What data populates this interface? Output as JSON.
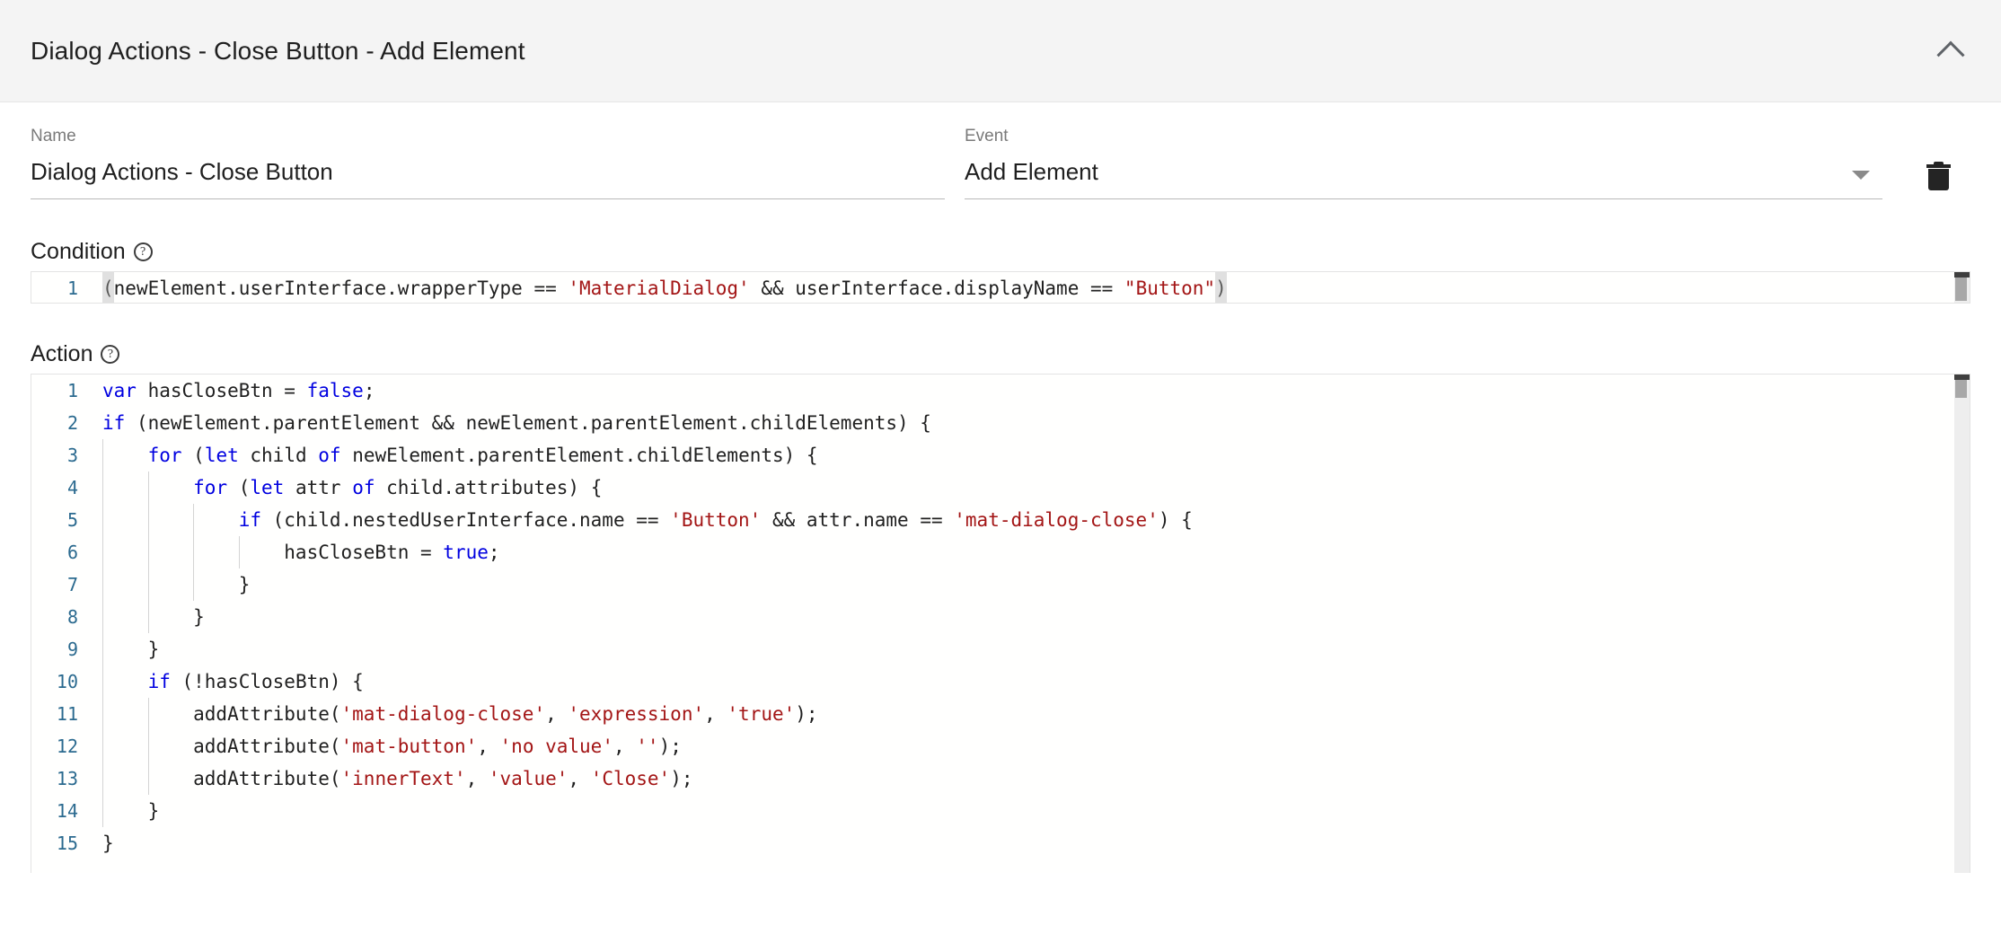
{
  "header": {
    "title": "Dialog Actions - Close Button - Add Element",
    "collapse_icon": "chevron-up-icon"
  },
  "form": {
    "name": {
      "label": "Name",
      "value": "Dialog Actions - Close Button"
    },
    "event": {
      "label": "Event",
      "value": "Add Element",
      "caret_icon": "chevron-down-icon"
    },
    "delete_icon": "trash-icon"
  },
  "condition": {
    "label": "Condition",
    "help_icon": "help-circle-icon",
    "help_glyph": "?",
    "lines": [
      {
        "num": "1",
        "indent": 0,
        "tokens": [
          {
            "t": "(",
            "c": "pl",
            "cursor": true
          },
          {
            "t": "newElement.userInterface.wrapperType == ",
            "c": "pl"
          },
          {
            "t": "'MaterialDialog'",
            "c": "str"
          },
          {
            "t": " && userInterface.displayName == ",
            "c": "pl"
          },
          {
            "t": "\"Button\"",
            "c": "str"
          },
          {
            "t": ")",
            "c": "pl",
            "cursor": true
          }
        ]
      }
    ]
  },
  "action": {
    "label": "Action",
    "help_icon": "help-circle-icon",
    "help_glyph": "?",
    "lines": [
      {
        "num": "1",
        "indent": 0,
        "tokens": [
          {
            "t": "var",
            "c": "kw"
          },
          {
            "t": " hasCloseBtn = ",
            "c": "pl"
          },
          {
            "t": "false",
            "c": "kw"
          },
          {
            "t": ";",
            "c": "pl"
          }
        ]
      },
      {
        "num": "2",
        "indent": 0,
        "tokens": [
          {
            "t": "if",
            "c": "kw"
          },
          {
            "t": " (newElement.parentElement && newElement.parentElement.childElements) {",
            "c": "pl"
          }
        ]
      },
      {
        "num": "3",
        "indent": 1,
        "tokens": [
          {
            "t": "    ",
            "c": "pl"
          },
          {
            "t": "for",
            "c": "kw"
          },
          {
            "t": " (",
            "c": "pl"
          },
          {
            "t": "let",
            "c": "kw"
          },
          {
            "t": " child ",
            "c": "pl"
          },
          {
            "t": "of",
            "c": "kw"
          },
          {
            "t": " newElement.parentElement.childElements) {",
            "c": "pl"
          }
        ]
      },
      {
        "num": "4",
        "indent": 2,
        "tokens": [
          {
            "t": "        ",
            "c": "pl"
          },
          {
            "t": "for",
            "c": "kw"
          },
          {
            "t": " (",
            "c": "pl"
          },
          {
            "t": "let",
            "c": "kw"
          },
          {
            "t": " attr ",
            "c": "pl"
          },
          {
            "t": "of",
            "c": "kw"
          },
          {
            "t": " child.attributes) {",
            "c": "pl"
          }
        ]
      },
      {
        "num": "5",
        "indent": 3,
        "tokens": [
          {
            "t": "            ",
            "c": "pl"
          },
          {
            "t": "if",
            "c": "kw"
          },
          {
            "t": " (child.nestedUserInterface.name == ",
            "c": "pl"
          },
          {
            "t": "'Button'",
            "c": "str"
          },
          {
            "t": " && attr.name == ",
            "c": "pl"
          },
          {
            "t": "'mat-dialog-close'",
            "c": "str"
          },
          {
            "t": ") {",
            "c": "pl"
          }
        ]
      },
      {
        "num": "6",
        "indent": 4,
        "tokens": [
          {
            "t": "                hasCloseBtn = ",
            "c": "pl"
          },
          {
            "t": "true",
            "c": "kw"
          },
          {
            "t": ";",
            "c": "pl"
          }
        ]
      },
      {
        "num": "7",
        "indent": 3,
        "tokens": [
          {
            "t": "            }",
            "c": "pl"
          }
        ]
      },
      {
        "num": "8",
        "indent": 2,
        "tokens": [
          {
            "t": "        }",
            "c": "pl"
          }
        ]
      },
      {
        "num": "9",
        "indent": 1,
        "tokens": [
          {
            "t": "    }",
            "c": "pl"
          }
        ]
      },
      {
        "num": "10",
        "indent": 1,
        "tokens": [
          {
            "t": "    ",
            "c": "pl"
          },
          {
            "t": "if",
            "c": "kw"
          },
          {
            "t": " (!hasCloseBtn) {",
            "c": "pl"
          }
        ]
      },
      {
        "num": "11",
        "indent": 2,
        "tokens": [
          {
            "t": "        addAttribute(",
            "c": "pl"
          },
          {
            "t": "'mat-dialog-close'",
            "c": "str"
          },
          {
            "t": ", ",
            "c": "pl"
          },
          {
            "t": "'expression'",
            "c": "str"
          },
          {
            "t": ", ",
            "c": "pl"
          },
          {
            "t": "'true'",
            "c": "str"
          },
          {
            "t": ");",
            "c": "pl"
          }
        ]
      },
      {
        "num": "12",
        "indent": 2,
        "tokens": [
          {
            "t": "        addAttribute(",
            "c": "pl"
          },
          {
            "t": "'mat-button'",
            "c": "str"
          },
          {
            "t": ", ",
            "c": "pl"
          },
          {
            "t": "'no value'",
            "c": "str"
          },
          {
            "t": ", ",
            "c": "pl"
          },
          {
            "t": "''",
            "c": "str"
          },
          {
            "t": ");",
            "c": "pl"
          }
        ]
      },
      {
        "num": "13",
        "indent": 2,
        "tokens": [
          {
            "t": "        addAttribute(",
            "c": "pl"
          },
          {
            "t": "'innerText'",
            "c": "str"
          },
          {
            "t": ", ",
            "c": "pl"
          },
          {
            "t": "'value'",
            "c": "str"
          },
          {
            "t": ", ",
            "c": "pl"
          },
          {
            "t": "'Close'",
            "c": "str"
          },
          {
            "t": ");",
            "c": "pl"
          }
        ]
      },
      {
        "num": "14",
        "indent": 1,
        "tokens": [
          {
            "t": "    }",
            "c": "pl"
          }
        ]
      },
      {
        "num": "15",
        "indent": 0,
        "tokens": [
          {
            "t": "}",
            "c": "pl"
          }
        ]
      }
    ]
  }
}
